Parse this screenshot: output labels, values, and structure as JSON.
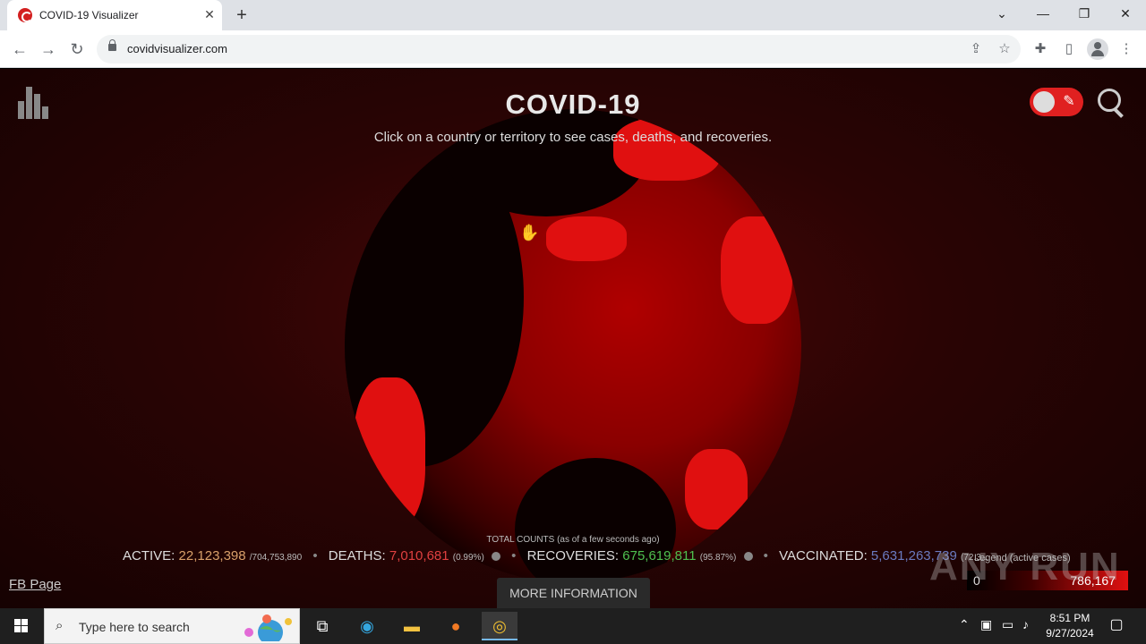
{
  "browser": {
    "tab_title": "COVID-19 Visualizer",
    "tab_close": "✕",
    "new_tab": "+",
    "url": "covidvisualizer.com",
    "window_controls": {
      "tab_search": "⌄",
      "minimize": "—",
      "restore": "❐",
      "close": "✕"
    }
  },
  "page": {
    "title": "COVID-19",
    "subtitle": "Click on a country or territory to see cases, deaths, and recoveries.",
    "total_caption": "TOTAL COUNTS (as of a few seconds ago)",
    "stats": {
      "active_label": "ACTIVE:",
      "active_value": "22,123,398",
      "active_total": "/704,753,890",
      "deaths_label": "DEATHS:",
      "deaths_value": "7,010,681",
      "deaths_pct": "(0.99%)",
      "recoveries_label": "RECOVERIES:",
      "recoveries_value": "675,619,811",
      "recoveries_pct": "(95.87%)",
      "vaccinated_label": "VACCINATED:",
      "vaccinated_value": "5,631,263,739",
      "vaccinated_pct": "(72.3..."
    },
    "fb_link": "FB Page",
    "more_button": "MORE INFORMATION",
    "legend": {
      "title": "Legend (active cases)",
      "min": "0",
      "max": "786,167"
    },
    "watermark": "ANY RUN",
    "colors": {
      "accent": "#e02020",
      "active": "#d9a06a",
      "deaths": "#e04040",
      "recoveries": "#4fc04f",
      "vaccinated": "#6a7ac0"
    }
  },
  "taskbar": {
    "search_placeholder": "Type here to search",
    "time": "8:51 PM",
    "date": "9/27/2024"
  }
}
